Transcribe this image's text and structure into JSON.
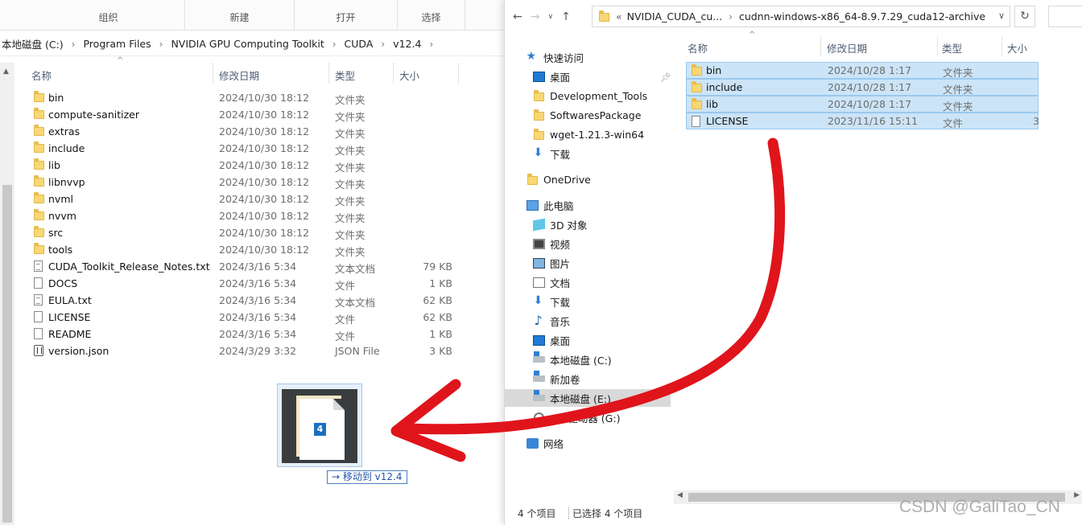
{
  "left": {
    "ribbon": [
      {
        "label": "组织"
      },
      {
        "label": "新建"
      },
      {
        "label": "打开"
      },
      {
        "label": "选择"
      }
    ],
    "breadcrumb": [
      "本地磁盘 (C:)",
      "Program Files",
      "NVIDIA GPU Computing Toolkit",
      "CUDA",
      "v12.4"
    ],
    "columns": {
      "name": "名称",
      "date": "修改日期",
      "type": "类型",
      "size": "大小"
    },
    "files": [
      {
        "name": "bin",
        "date": "2024/10/30 18:12",
        "type": "文件夹",
        "size": "",
        "icon": "folder"
      },
      {
        "name": "compute-sanitizer",
        "date": "2024/10/30 18:12",
        "type": "文件夹",
        "size": "",
        "icon": "folder"
      },
      {
        "name": "extras",
        "date": "2024/10/30 18:12",
        "type": "文件夹",
        "size": "",
        "icon": "folder"
      },
      {
        "name": "include",
        "date": "2024/10/30 18:12",
        "type": "文件夹",
        "size": "",
        "icon": "folder"
      },
      {
        "name": "lib",
        "date": "2024/10/30 18:12",
        "type": "文件夹",
        "size": "",
        "icon": "folder"
      },
      {
        "name": "libnvvp",
        "date": "2024/10/30 18:12",
        "type": "文件夹",
        "size": "",
        "icon": "folder"
      },
      {
        "name": "nvml",
        "date": "2024/10/30 18:12",
        "type": "文件夹",
        "size": "",
        "icon": "folder"
      },
      {
        "name": "nvvm",
        "date": "2024/10/30 18:12",
        "type": "文件夹",
        "size": "",
        "icon": "folder"
      },
      {
        "name": "src",
        "date": "2024/10/30 18:12",
        "type": "文件夹",
        "size": "",
        "icon": "folder"
      },
      {
        "name": "tools",
        "date": "2024/10/30 18:12",
        "type": "文件夹",
        "size": "",
        "icon": "folder"
      },
      {
        "name": "CUDA_Toolkit_Release_Notes.txt",
        "date": "2024/3/16 5:34",
        "type": "文本文档",
        "size": "79 KB",
        "icon": "txt"
      },
      {
        "name": "DOCS",
        "date": "2024/3/16 5:34",
        "type": "文件",
        "size": "1 KB",
        "icon": "file"
      },
      {
        "name": "EULA.txt",
        "date": "2024/3/16 5:34",
        "type": "文本文档",
        "size": "62 KB",
        "icon": "txt"
      },
      {
        "name": "LICENSE",
        "date": "2024/3/16 5:34",
        "type": "文件",
        "size": "62 KB",
        "icon": "file"
      },
      {
        "name": "README",
        "date": "2024/3/16 5:34",
        "type": "文件",
        "size": "1 KB",
        "icon": "file"
      },
      {
        "name": "version.json",
        "date": "2024/3/29 3:32",
        "type": "JSON File",
        "size": "3 KB",
        "icon": "json"
      }
    ],
    "drag": {
      "count": "4",
      "tooltip": "→ 移动到 v12.4"
    }
  },
  "right": {
    "address": {
      "prefix": "«",
      "parts": [
        "NVIDIA_CUDA_cu...",
        "cudnn-windows-x86_64-8.9.7.29_cuda12-archive"
      ]
    },
    "nav": [
      {
        "label": "快速访问",
        "icon": "star-icon"
      },
      {
        "label": "桌面",
        "icon": "desktop-icon"
      },
      {
        "label": "Development_Tools",
        "icon": "folder-icon"
      },
      {
        "label": "SoftwaresPackage",
        "icon": "folder-icon"
      },
      {
        "label": "wget-1.21.3-win64",
        "icon": "folder-icon"
      },
      {
        "label": "下载",
        "icon": "download-icon"
      },
      {
        "label": "OneDrive",
        "icon": "folder-icon"
      },
      {
        "label": "此电脑",
        "icon": "pc-icon"
      },
      {
        "label": "3D 对象",
        "icon": "cube-icon"
      },
      {
        "label": "视频",
        "icon": "video-icon"
      },
      {
        "label": "图片",
        "icon": "picture-icon"
      },
      {
        "label": "文档",
        "icon": "document-icon"
      },
      {
        "label": "下载",
        "icon": "download-icon"
      },
      {
        "label": "音乐",
        "icon": "music-icon"
      },
      {
        "label": "桌面",
        "icon": "desktop-icon"
      },
      {
        "label": "本地磁盘 (C:)",
        "icon": "drive-icon"
      },
      {
        "label": "新加卷",
        "icon": "drive-icon"
      },
      {
        "label": "本地磁盘 (E:)",
        "icon": "drive-icon"
      },
      {
        "label": "CD 驱动器 (G:)",
        "icon": "cd-icon"
      },
      {
        "label": "网络",
        "icon": "network-icon"
      }
    ],
    "columns": {
      "name": "名称",
      "date": "修改日期",
      "type": "类型",
      "size": "大小"
    },
    "files": [
      {
        "name": "bin",
        "date": "2024/10/28 1:17",
        "type": "文件夹",
        "size": ""
      },
      {
        "name": "include",
        "date": "2024/10/28 1:17",
        "type": "文件夹",
        "size": ""
      },
      {
        "name": "lib",
        "date": "2024/10/28 1:17",
        "type": "文件夹",
        "size": ""
      },
      {
        "name": "LICENSE",
        "date": "2023/11/16 15:11",
        "type": "文件",
        "size": "3"
      }
    ],
    "status": {
      "count": "4 个项目",
      "selected": "已选择 4 个项目"
    }
  },
  "watermark": "CSDN @GaliTao_CN",
  "colors": {
    "selection": "#cce4f7",
    "arrow": "#e0141b",
    "folder": "#f8d775"
  }
}
